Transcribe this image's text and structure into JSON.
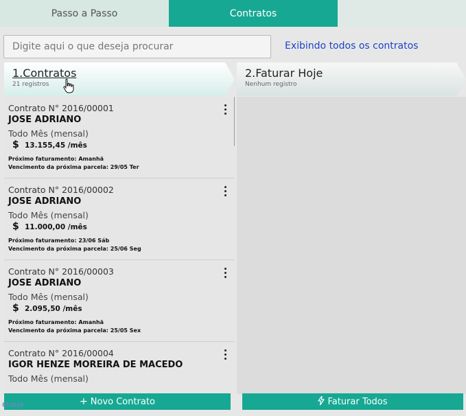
{
  "tabs": [
    {
      "label": "Passo a Passo"
    },
    {
      "label": "Contratos"
    }
  ],
  "search": {
    "placeholder": "Digite aqui o que deseja procurar",
    "filter_link": "Exibindo todos os contratos"
  },
  "steps": [
    {
      "title": "1.Contratos",
      "subtitle": "21 registros"
    },
    {
      "title": "2.Faturar Hoje",
      "subtitle": "Nenhum registro"
    }
  ],
  "contracts": [
    {
      "number": "Contrato N° 2016/00001",
      "client": "JOSE ADRIANO",
      "frequency": "Todo Mês (mensal)",
      "currency_symbol": "$",
      "amount": "13.155,45 /mês",
      "next_billing": "Próximo faturamento: Amanhã",
      "next_due": "Vencimento da próxima parcela: 29/05 Ter"
    },
    {
      "number": "Contrato N° 2016/00002",
      "client": "JOSE ADRIANO",
      "frequency": "Todo Mês (mensal)",
      "currency_symbol": "$",
      "amount": "11.000,00 /mês",
      "next_billing": "Próximo faturamento: 23/06 Sáb",
      "next_due": "Vencimento da próxima parcela: 25/06 Seg"
    },
    {
      "number": "Contrato N° 2016/00003",
      "client": "JOSE ADRIANO",
      "frequency": "Todo Mês (mensal)",
      "currency_symbol": "$",
      "amount": "2.095,50 /mês",
      "next_billing": "Próximo faturamento: Amanhã",
      "next_due": "Vencimento da próxima parcela: 25/05 Sex"
    },
    {
      "number": "Contrato N° 2016/00004",
      "client": "IGOR HENZE MOREIRA DE MACEDO",
      "frequency": "Todo Mês (mensal)",
      "currency_symbol": "$",
      "amount": "",
      "next_billing": "",
      "next_due": ""
    }
  ],
  "buttons": {
    "new_contract": "Novo Contrato",
    "bill_all": "Faturar Todos"
  },
  "logo_text": "Omie",
  "colors": {
    "accent": "#17a893",
    "link": "#1d44c9"
  },
  "icons": {
    "plus": "plus-icon",
    "bolt": "lightning-icon",
    "menu": "kebab-menu-icon",
    "cursor": "hand-cursor-icon"
  }
}
